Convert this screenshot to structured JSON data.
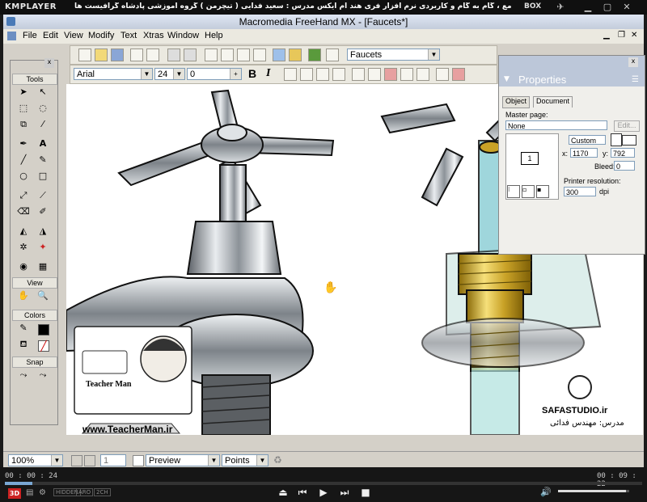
{
  "player": {
    "brand": "KMPLAYER",
    "title": "مجموعه آموزشی جامع ، گام به گام و کاربردی نرم افزار فری هند ام ایکس   مدرس : سعید فدایی ( تیچرمن ) گروه آموزشی پادشاه گرافیست ها",
    "box_label": "BOX",
    "time_current": "00 : 00 : 24",
    "time_total": "00 : 09 : 22",
    "progress_fraction": 0.043,
    "volume_fraction": 0.95,
    "badge_3d": "3D",
    "view_modes": [
      "HIDDEN",
      "ARO",
      "2CH"
    ]
  },
  "app": {
    "title": "Macromedia FreeHand MX - [Faucets*]",
    "menu": [
      "File",
      "Edit",
      "View",
      "Modify",
      "Text",
      "Xtras",
      "Window",
      "Help"
    ],
    "document_dropdown": "Faucets",
    "font_name": "Arial",
    "font_size": "24",
    "tracking": "0",
    "style_buttons": [
      "B",
      "I"
    ]
  },
  "tools_panel": {
    "sections": [
      "Tools",
      "View",
      "Colors",
      "Snap"
    ]
  },
  "properties_panel": {
    "title": "Properties",
    "tabs": [
      "Object",
      "Document"
    ],
    "master_page_label": "Master page:",
    "master_page_value": "None",
    "edit_button": "Edit...",
    "page_number": "1",
    "size_dropdown": "Custom",
    "x_label": "x:",
    "x_value": "1170",
    "y_label": "y:",
    "y_value": "792",
    "bleed_label": "Bleed:",
    "bleed_value": "0",
    "printer_resolution_label": "Printer resolution:",
    "printer_resolution_value": "300",
    "dpi_label": "dpi"
  },
  "canvas": {
    "watermark_name": "Teacher Man",
    "watermark_url": "www.TeacherMan.ir",
    "studio": "SAFASTUDIO.ir",
    "studio_teacher": "مدرس: مهندس فدائی"
  },
  "statusbar": {
    "zoom": "100%",
    "page": "1",
    "view_mode": "Preview",
    "units": "Points"
  },
  "colors": {
    "brass": "#c9a227",
    "chrome": "#9aa0a6",
    "accent": "#7aa7d4"
  }
}
